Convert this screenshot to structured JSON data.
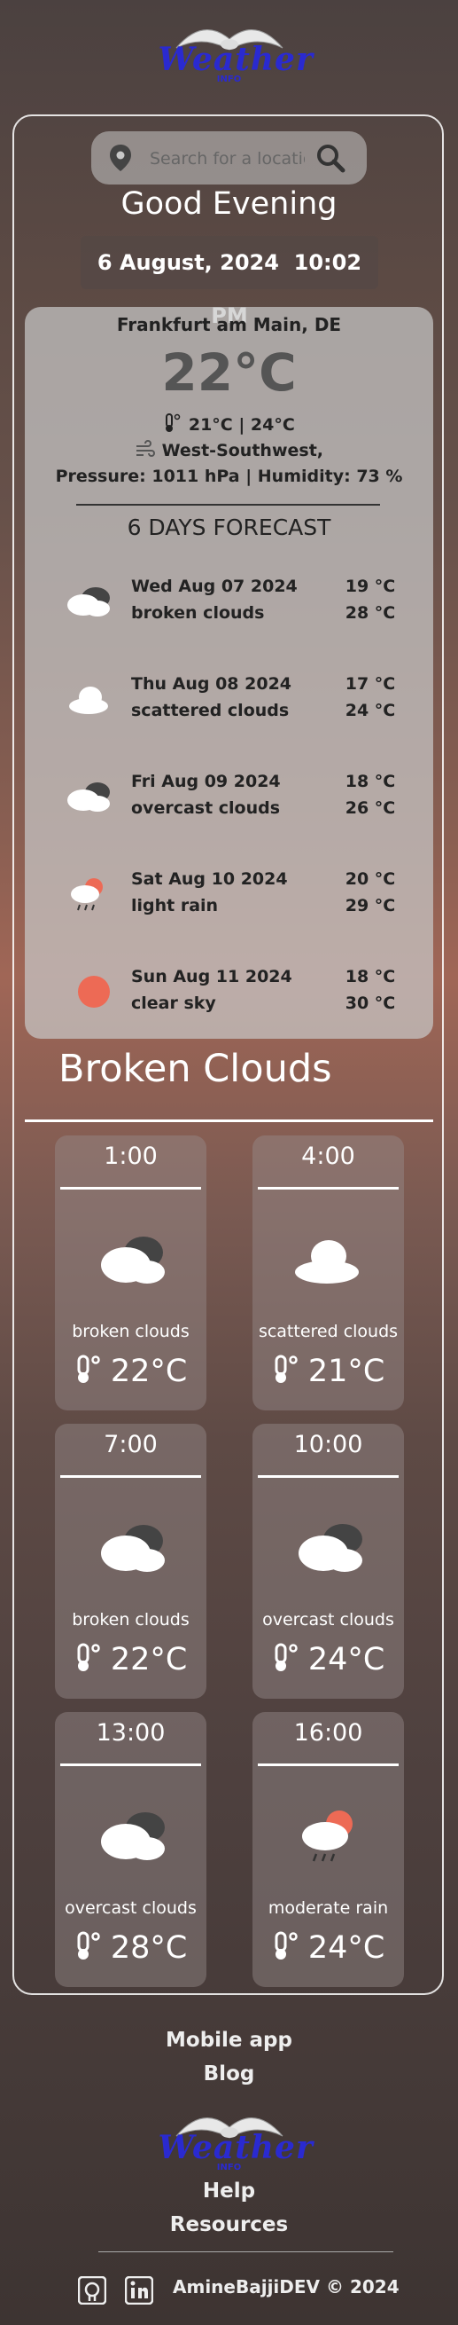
{
  "logo": {
    "text": "Weather",
    "sub": "INFO"
  },
  "search": {
    "placeholder": "Search for a location"
  },
  "greeting": "Good Evening",
  "datetime": {
    "date": "6 August, 2024",
    "time": "10:02 PM"
  },
  "current": {
    "city": "Frankfurt am Main, DE",
    "temp": "22°C",
    "min_max": "21°C | 24°C",
    "wind": "West-Southwest,",
    "pressure_humidity": "Pressure: 1011 hPa | Humidity: 73 %"
  },
  "forecast": {
    "title": "6 DAYS FORECAST",
    "days": [
      {
        "date": "Wed Aug 07 2024",
        "desc": "broken clouds",
        "min": "19 °C",
        "max": "28 °C",
        "icon": "broken-clouds-icon"
      },
      {
        "date": "Thu Aug 08 2024",
        "desc": "scattered clouds",
        "min": "17 °C",
        "max": "24 °C",
        "icon": "scattered-clouds-icon"
      },
      {
        "date": "Fri Aug 09 2024",
        "desc": "overcast clouds",
        "min": "18 °C",
        "max": "26 °C",
        "icon": "overcast-clouds-icon"
      },
      {
        "date": "Sat Aug 10 2024",
        "desc": "light rain",
        "min": "20 °C",
        "max": "29 °C",
        "icon": "rain-icon"
      },
      {
        "date": "Sun Aug 11 2024",
        "desc": "clear sky",
        "min": "18 °C",
        "max": "30 °C",
        "icon": "clear-sky-icon"
      }
    ]
  },
  "condition_title": "Broken Clouds",
  "hourly": [
    {
      "time": "1:00",
      "desc": "broken clouds",
      "temp": "22°C",
      "icon": "broken-clouds-icon"
    },
    {
      "time": "4:00",
      "desc": "scattered clouds",
      "temp": "21°C",
      "icon": "scattered-clouds-icon"
    },
    {
      "time": "7:00",
      "desc": "broken clouds",
      "temp": "22°C",
      "icon": "broken-clouds-icon"
    },
    {
      "time": "10:00",
      "desc": "overcast clouds",
      "temp": "24°C",
      "icon": "overcast-clouds-icon"
    },
    {
      "time": "13:00",
      "desc": "overcast clouds",
      "temp": "28°C",
      "icon": "overcast-clouds-icon"
    },
    {
      "time": "16:00",
      "desc": "moderate rain",
      "temp": "24°C",
      "icon": "rain-icon"
    }
  ],
  "footer": {
    "links": [
      "Mobile app",
      "Blog",
      "Help",
      "Resources"
    ],
    "copyright": "AmineBajjiDEV © 2024"
  },
  "colors": {
    "accent": "#ed6a55",
    "logo": "#2a2ad0"
  }
}
